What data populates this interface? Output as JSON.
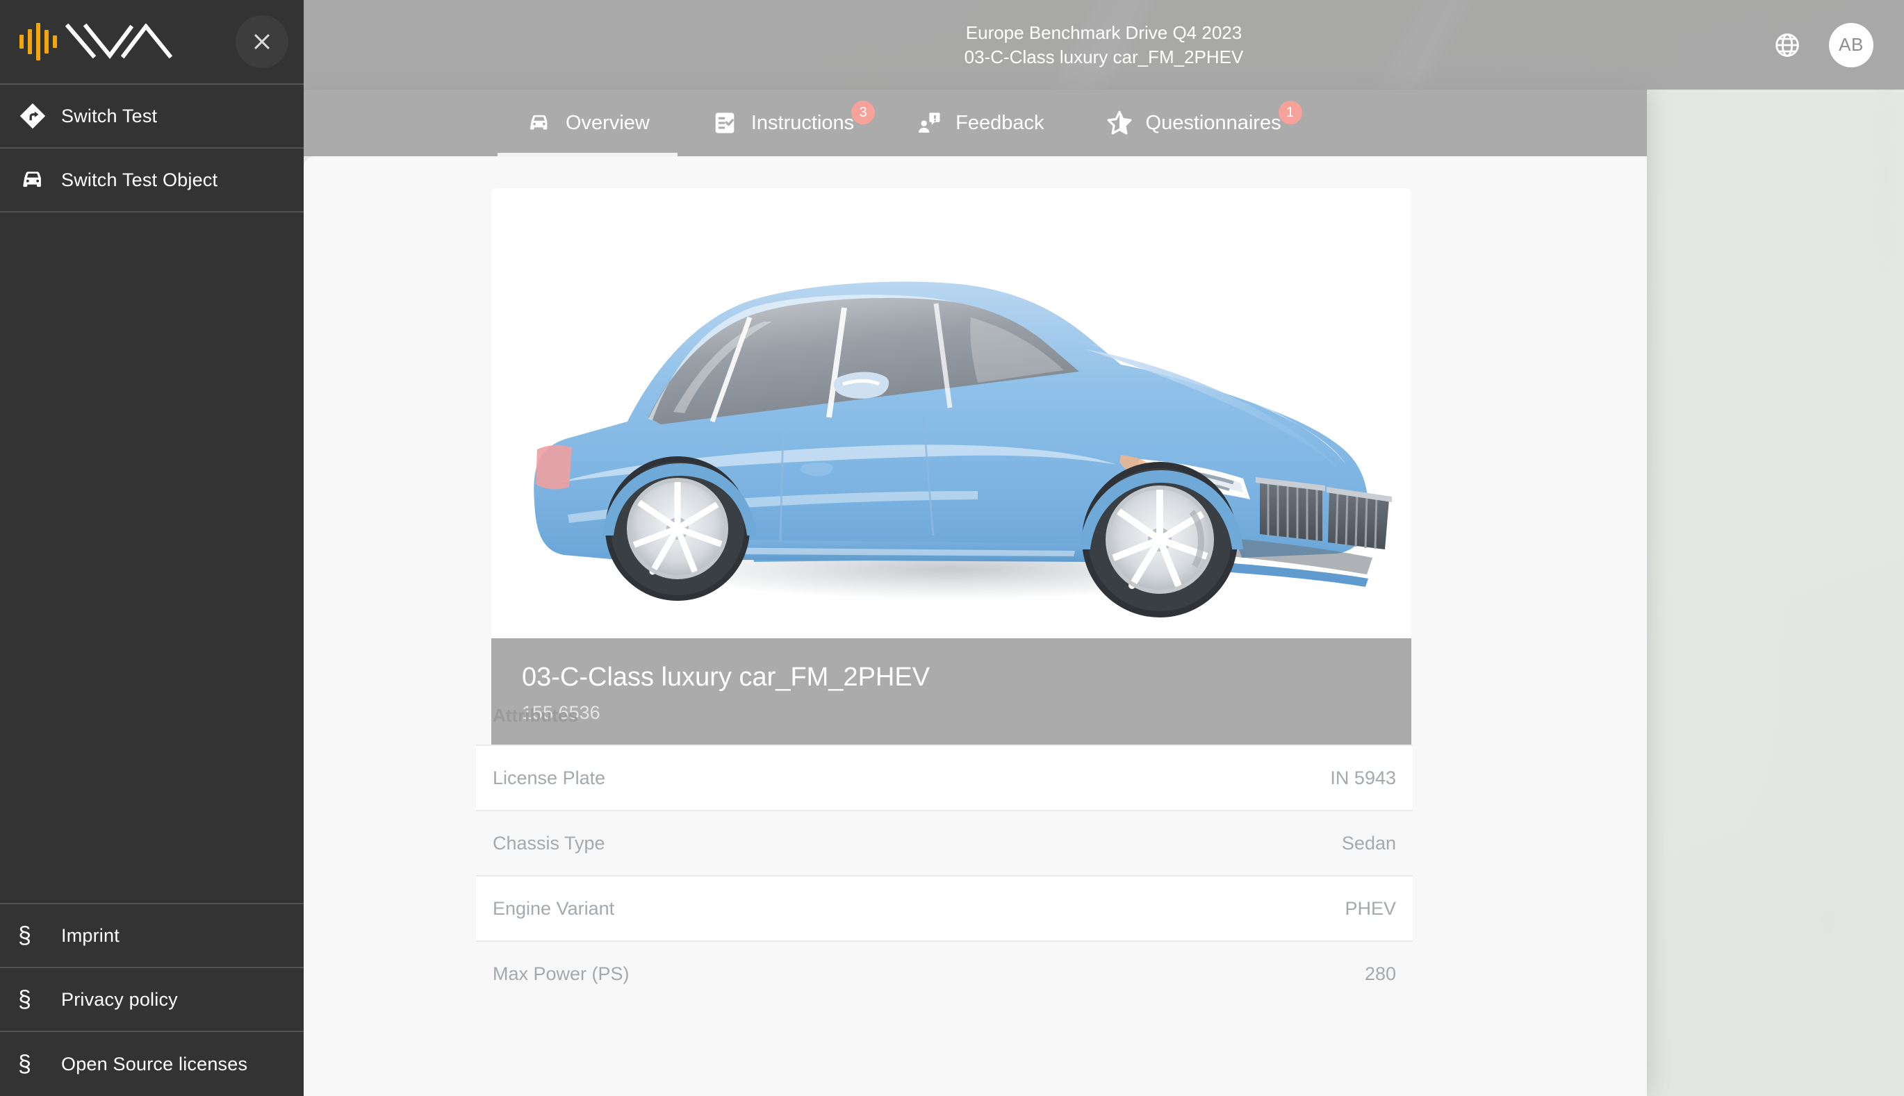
{
  "app": {
    "logo_name": "waveform-mountain-logo",
    "accent_color": "#f2a60c",
    "sidebar_bg": "#333333",
    "badge_color": "#f6a29b"
  },
  "sidebar": {
    "close_label": "✕",
    "items": [
      {
        "label": "Switch Test",
        "icon": "turn-right-diamond-icon"
      },
      {
        "label": "Switch Test Object",
        "icon": "car-front-icon"
      }
    ],
    "footer_items": [
      {
        "label": "Imprint",
        "icon": "section-sign-icon",
        "glyph": "§"
      },
      {
        "label": "Privacy policy",
        "icon": "section-sign-icon",
        "glyph": "§"
      },
      {
        "label": "Open Source licenses",
        "icon": "section-sign-icon",
        "glyph": "§"
      }
    ]
  },
  "topbar": {
    "line1": "Europe Benchmark Drive Q4 2023",
    "line2": "03-C-Class luxury car_FM_2PHEV",
    "language_icon": "globe-icon",
    "avatar_initials": "AB"
  },
  "tabs": [
    {
      "label": "Overview",
      "icon": "car-front-icon",
      "badge": "",
      "active": true
    },
    {
      "label": "Instructions",
      "icon": "checklist-icon",
      "badge": "3",
      "active": false
    },
    {
      "label": "Feedback",
      "icon": "person-speech-bubble-icon",
      "badge": "",
      "active": false
    },
    {
      "label": "Questionnaires",
      "icon": "star-half-icon",
      "badge": "1",
      "active": false
    }
  ],
  "vehicle": {
    "image_alt": "blue-sedan-illustration",
    "name": "03-C-Class luxury car_FM_2PHEV",
    "identifier": "155 6536"
  },
  "attributes": {
    "title": "Attributes",
    "rows": [
      {
        "label": "License Plate",
        "value": "IN 5943"
      },
      {
        "label": "Chassis Type",
        "value": "Sedan"
      },
      {
        "label": "Engine Variant",
        "value": "PHEV"
      },
      {
        "label": "Max Power (PS)",
        "value": "280"
      }
    ]
  }
}
